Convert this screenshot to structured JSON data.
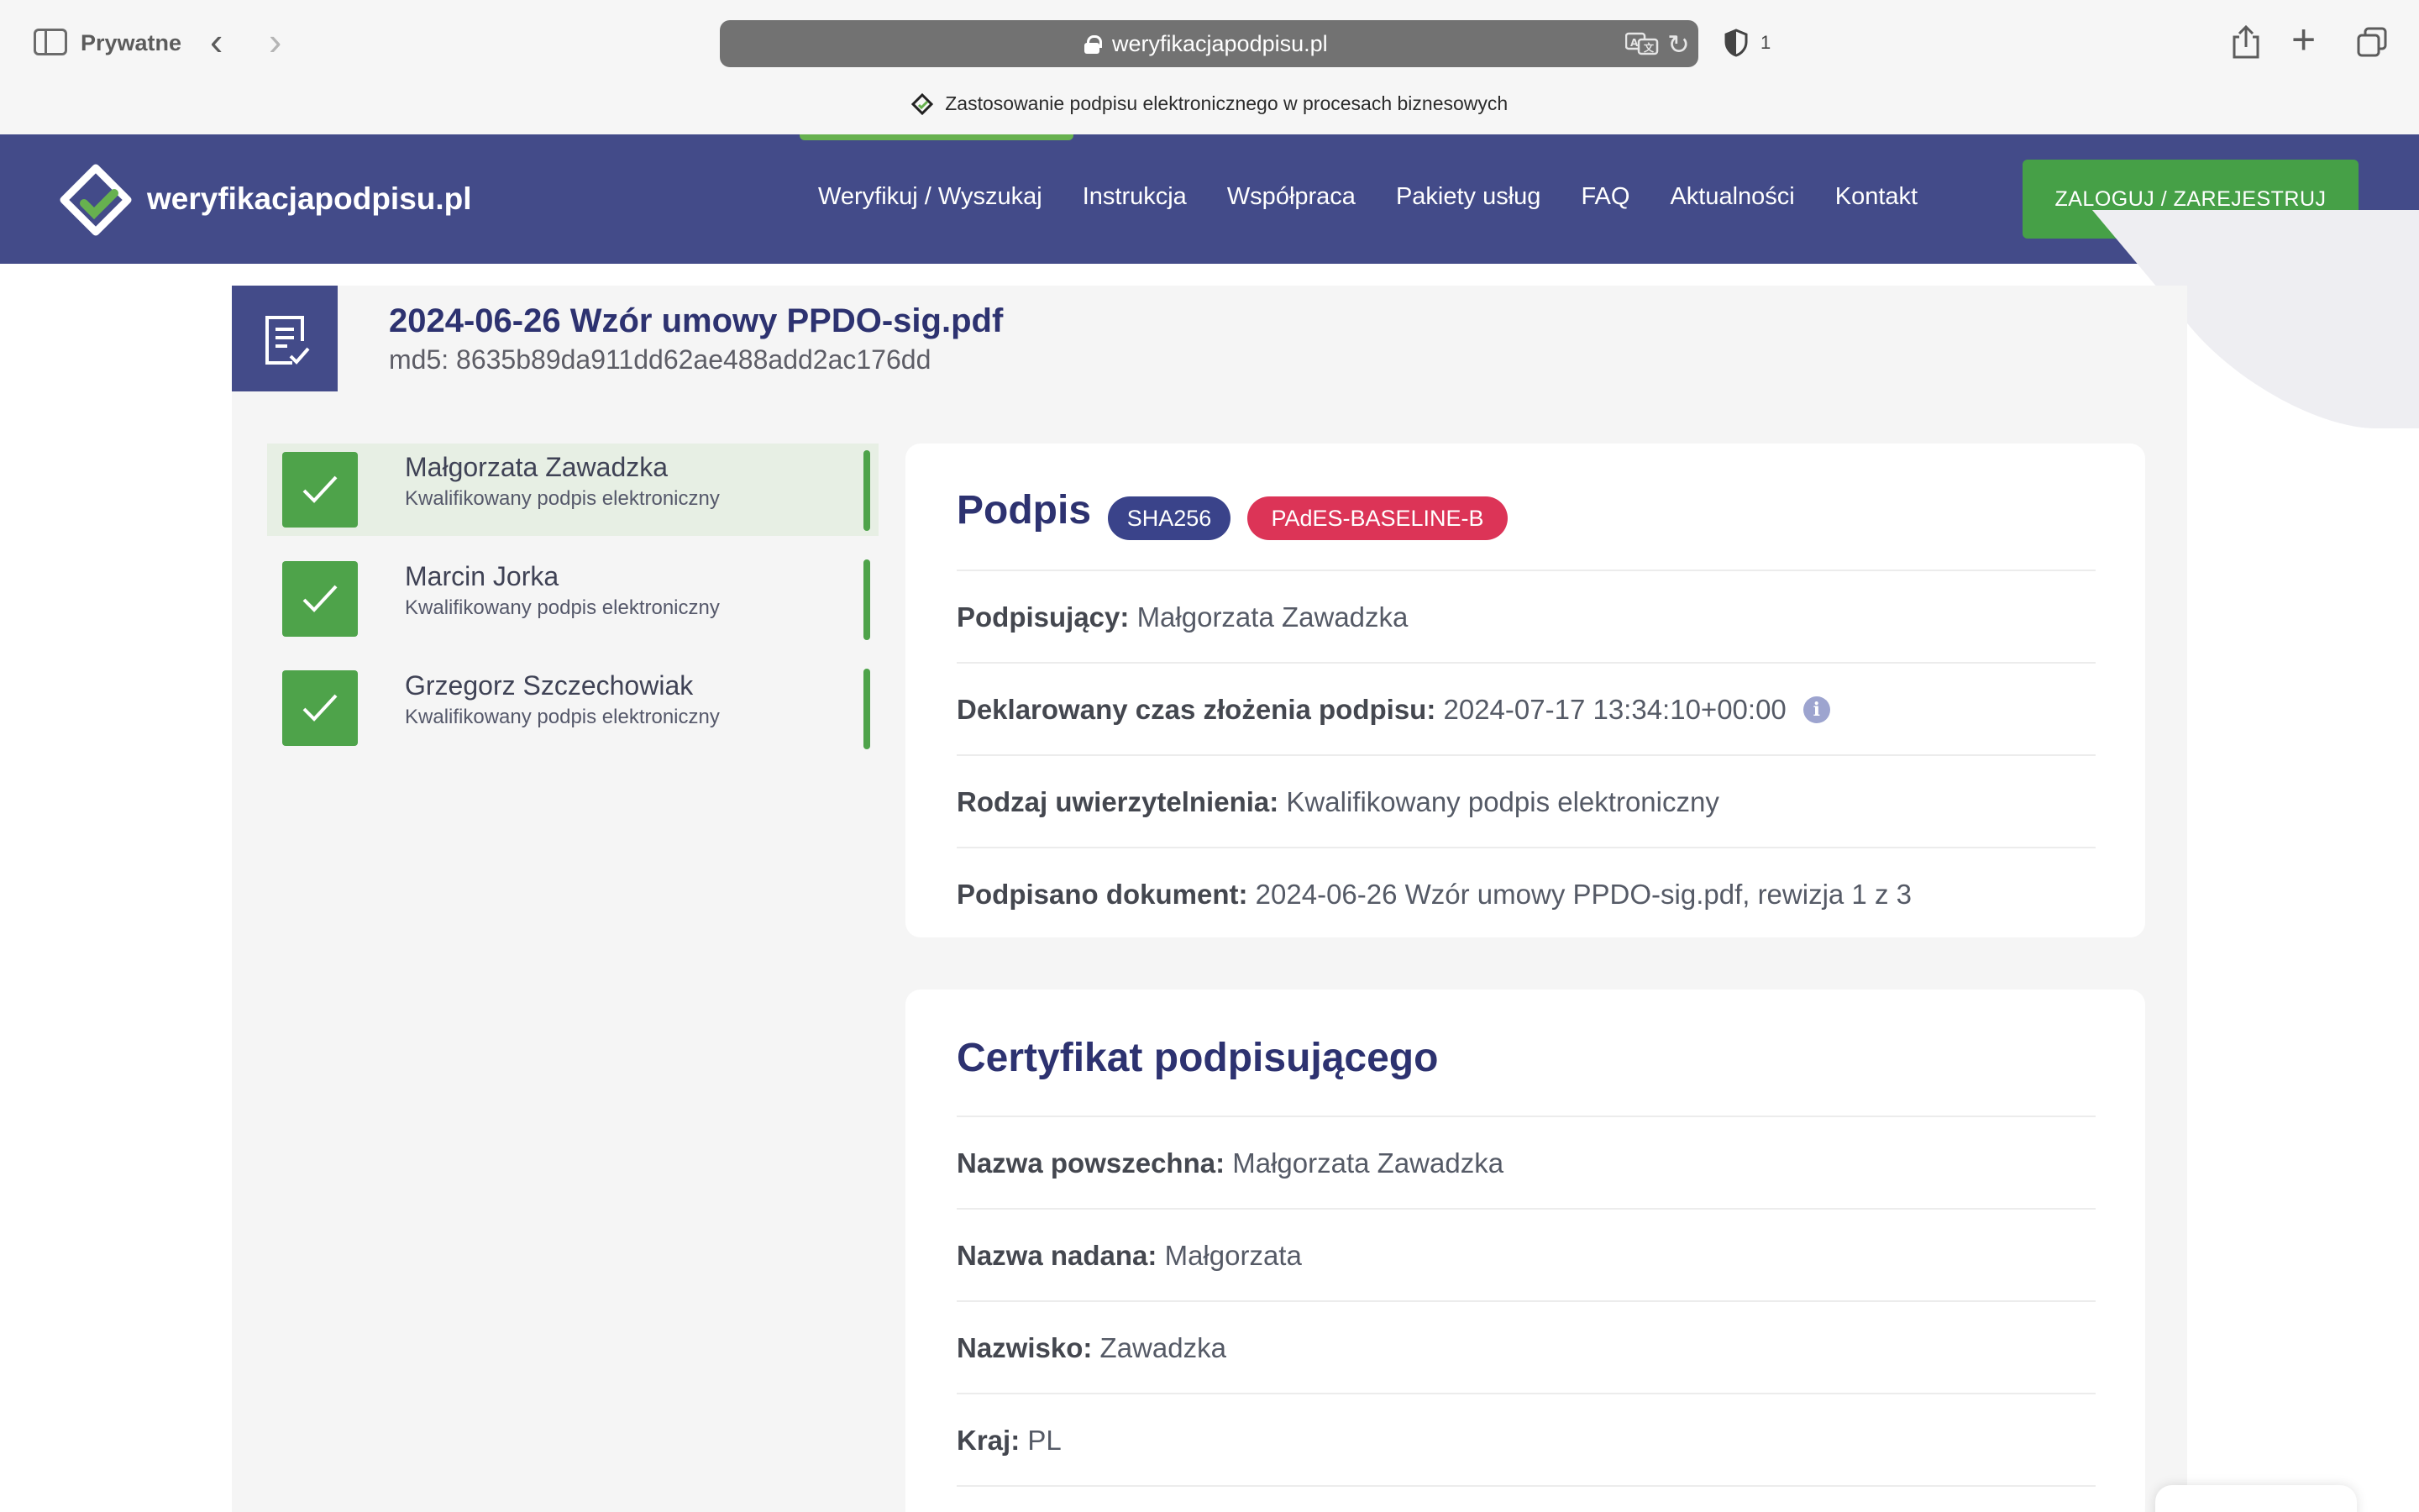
{
  "browser": {
    "private_label": "Prywatne",
    "url": "weryfikacjapodpisu.pl",
    "blocked_count": "1",
    "tab_title": "Zastosowanie podpisu elektronicznego w procesach biznesowych"
  },
  "header": {
    "logo_text": "weryfikacjapodpisu.pl",
    "nav": [
      "Weryfikuj / Wyszukaj",
      "Instrukcja",
      "Współpraca",
      "Pakiety usług",
      "FAQ",
      "Aktualności",
      "Kontakt"
    ],
    "login_label": "ZALOGUJ / ZAREJESTRUJ"
  },
  "document": {
    "title": "2024-06-26 Wzór umowy PPDO-sig.pdf",
    "md5": "md5: 8635b89da911dd62ae488add2ac176dd"
  },
  "signers": [
    {
      "name": "Małgorzata Zawadzka",
      "type": "Kwalifikowany podpis elektroniczny",
      "active": true
    },
    {
      "name": "Marcin Jorka",
      "type": "Kwalifikowany podpis elektroniczny",
      "active": false
    },
    {
      "name": "Grzegorz Szczechowiak",
      "type": "Kwalifikowany podpis elektroniczny",
      "active": false
    }
  ],
  "signature": {
    "title": "Podpis",
    "hash_badge": "SHA256",
    "format_badge": "PAdES-BASELINE-B",
    "rows": [
      {
        "label": "Podpisujący:",
        "value": "Małgorzata Zawadzka"
      },
      {
        "label": "Deklarowany czas złożenia podpisu:",
        "value": "2024-07-17 13:34:10+00:00"
      },
      {
        "label": "Rodzaj uwierzytelnienia:",
        "value": "Kwalifikowany podpis elektroniczny"
      },
      {
        "label": "Podpisano dokument:",
        "value": "2024-06-26 Wzór umowy PPDO-sig.pdf, rewizja 1 z 3"
      }
    ]
  },
  "certificate": {
    "title": "Certyfikat podpisującego",
    "rows": [
      {
        "label": "Nazwa powszechna:",
        "value": "Małgorzata Zawadzka"
      },
      {
        "label": "Nazwa nadana:",
        "value": "Małgorzata"
      },
      {
        "label": "Nazwisko:",
        "value": "Zawadzka"
      },
      {
        "label": "Kraj:",
        "value": "PL"
      }
    ]
  },
  "colors": {
    "brand_blue": "#434b89",
    "brand_green": "#4ea34a",
    "badge_red": "#dc3457"
  }
}
